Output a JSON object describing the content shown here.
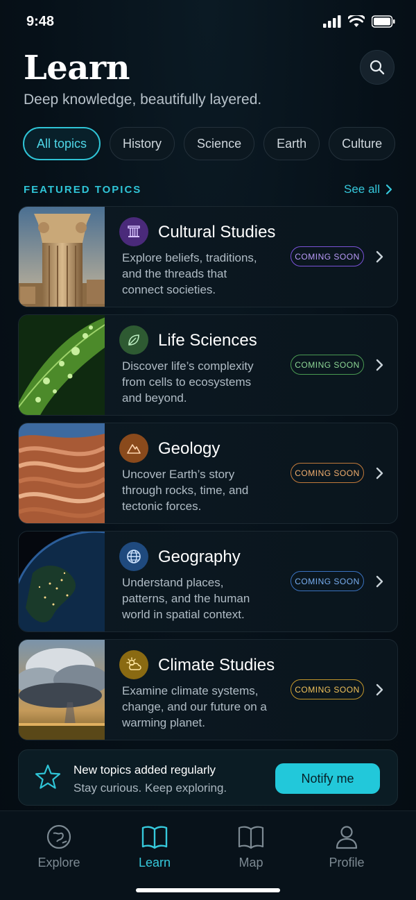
{
  "status_bar": {
    "time": "9:48"
  },
  "header": {
    "title": "Learn",
    "subtitle": "Deep knowledge, beautifully layered.",
    "search_icon": "search-icon"
  },
  "chips": [
    {
      "label": "All topics",
      "active": true
    },
    {
      "label": "History",
      "active": false
    },
    {
      "label": "Science",
      "active": false
    },
    {
      "label": "Earth",
      "active": false
    },
    {
      "label": "Culture",
      "active": false
    }
  ],
  "section": {
    "label": "FEATURED TOPICS",
    "see_all": "See all"
  },
  "topics": [
    {
      "title": "Cultural Studies",
      "desc": "Explore beliefs, traditions, and the threads that connect societies.",
      "badge": "COMING SOON",
      "icon": "column-icon",
      "accent": "#9b6cf0",
      "icon_bg": "#4a2a7a"
    },
    {
      "title": "Life Sciences",
      "desc": "Discover life’s complexity from cells to ecosystems and beyond.",
      "badge": "COMING SOON",
      "icon": "leaf-icon",
      "accent": "#7fd08a",
      "icon_bg": "#2e5a32"
    },
    {
      "title": "Geology",
      "desc": "Uncover Earth’s story through rocks, time, and tectonic forces.",
      "badge": "COMING SOON",
      "icon": "mountain-icon",
      "accent": "#e89a4a",
      "icon_bg": "#8a4a1c"
    },
    {
      "title": "Geography",
      "desc": "Understand places, patterns, and the human world in spatial context.",
      "badge": "COMING SOON",
      "icon": "globe-icon",
      "accent": "#5aa8f0",
      "icon_bg": "#1f4a7e"
    },
    {
      "title": "Climate Studies",
      "desc": "Examine climate systems, change, and our future on a warming planet.",
      "badge": "COMING SOON",
      "icon": "sun-cloud-icon",
      "accent": "#e8b63a",
      "icon_bg": "#8a6a12"
    }
  ],
  "banner": {
    "title": "New topics added regularly",
    "subtitle": "Stay curious. Keep exploring.",
    "button": "Notify me"
  },
  "tabs": [
    {
      "label": "Explore",
      "icon": "compass-icon",
      "active": false
    },
    {
      "label": "Learn",
      "icon": "book-icon",
      "active": true
    },
    {
      "label": "Map",
      "icon": "map-icon",
      "active": false
    },
    {
      "label": "Profile",
      "icon": "person-icon",
      "active": false
    }
  ],
  "colors": {
    "accent": "#2fc4d6",
    "background": "#061018"
  }
}
